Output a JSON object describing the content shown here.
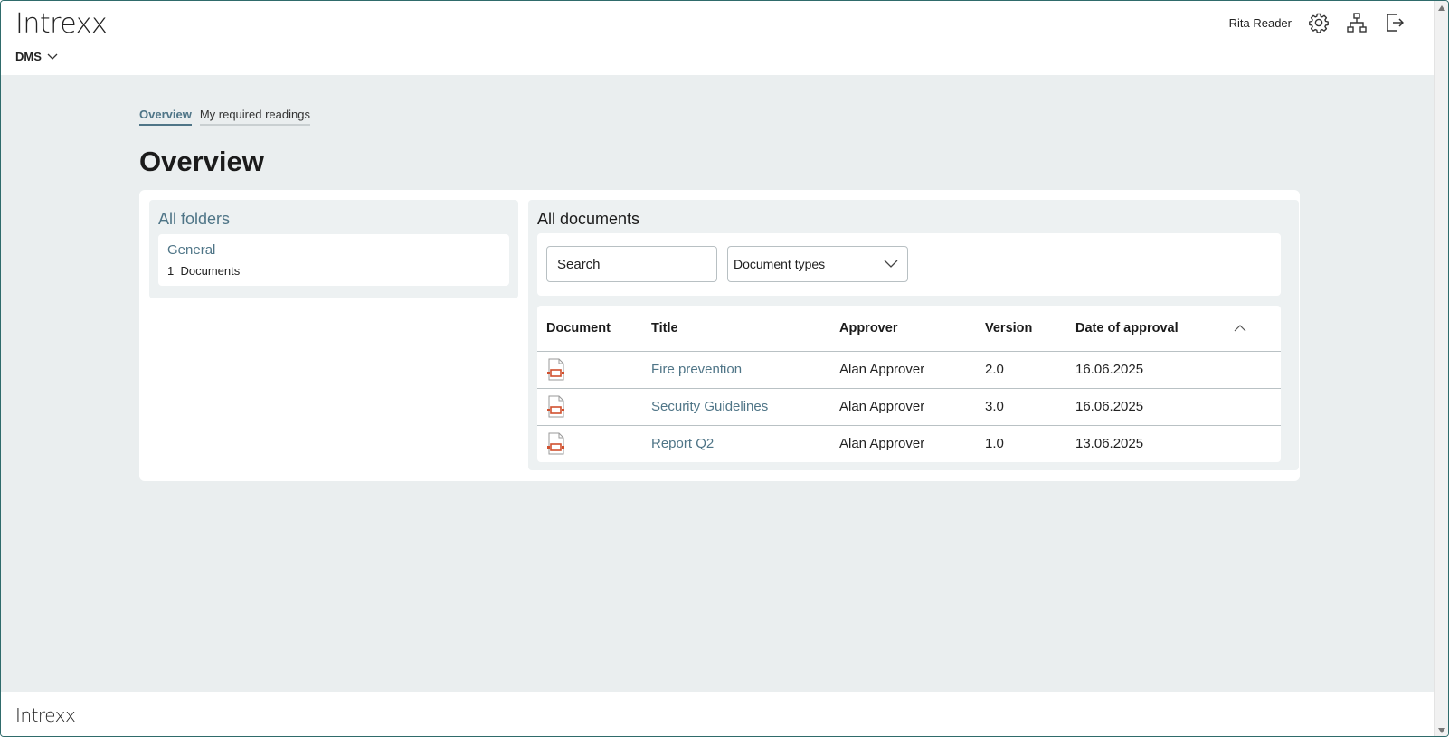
{
  "header": {
    "logo": "Intrexx",
    "app_menu_label": "DMS",
    "username": "Rita Reader"
  },
  "tabs": [
    {
      "label": "Overview",
      "active": true
    },
    {
      "label": "My required readings",
      "active": false
    }
  ],
  "page_title": "Overview",
  "folders": {
    "title": "All folders",
    "items": [
      {
        "name": "General",
        "count": "1",
        "count_label": "Documents"
      }
    ]
  },
  "documents": {
    "title": "All documents",
    "search_placeholder": "Search",
    "doc_type_select": "Document types",
    "columns": [
      "Document",
      "Title",
      "Approver",
      "Version",
      "Date of approval"
    ],
    "rows": [
      {
        "title": "Fire prevention",
        "approver": "Alan Approver",
        "version": "2.0",
        "date": "16.06.2025"
      },
      {
        "title": "Security Guidelines",
        "approver": "Alan Approver",
        "version": "3.0",
        "date": "16.06.2025"
      },
      {
        "title": "Report Q2",
        "approver": "Alan Approver",
        "version": "1.0",
        "date": "13.06.2025"
      }
    ]
  },
  "footer": {
    "logo": "Intrexx"
  },
  "icons": {
    "settings": "gear-icon",
    "sitemap": "sitemap-icon",
    "logout": "logout-icon",
    "document": "pdf-document-icon",
    "sort": "chevron-up-icon"
  },
  "colors": {
    "accent": "#4f7587",
    "background": "#eaeeef",
    "pdf_icon": "#d0502e"
  }
}
